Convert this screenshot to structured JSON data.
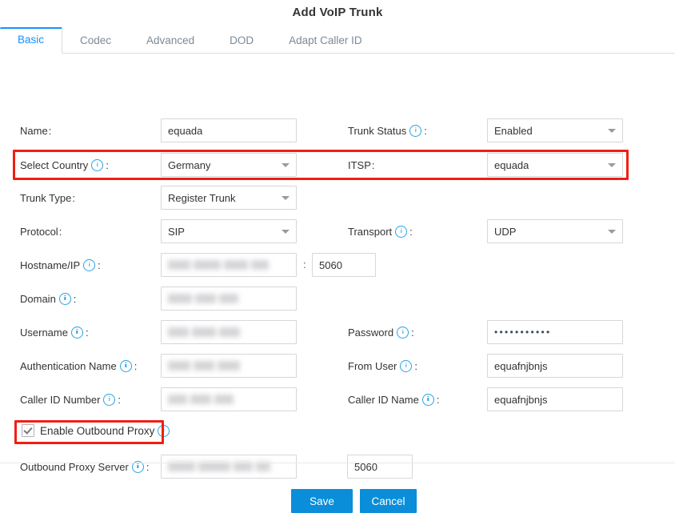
{
  "dialog": {
    "title": "Add VoIP Trunk"
  },
  "tabs": [
    {
      "label": "Basic",
      "active": true
    },
    {
      "label": "Codec",
      "active": false
    },
    {
      "label": "Advanced",
      "active": false
    },
    {
      "label": "DOD",
      "active": false
    },
    {
      "label": "Adapt Caller ID",
      "active": false
    }
  ],
  "fields": {
    "name": {
      "label": "Name",
      "value": "equada",
      "type": "text"
    },
    "trunk_status": {
      "label": "Trunk Status",
      "value": "Enabled",
      "type": "select",
      "info": true
    },
    "select_country": {
      "label": "Select Country",
      "value": "Germany",
      "type": "select",
      "info": true
    },
    "itsp": {
      "label": "ITSP",
      "value": "equada",
      "type": "select"
    },
    "trunk_type": {
      "label": "Trunk Type",
      "value": "Register Trunk",
      "type": "select"
    },
    "protocol": {
      "label": "Protocol",
      "value": "SIP",
      "type": "select"
    },
    "transport": {
      "label": "Transport",
      "value": "UDP",
      "type": "select",
      "info": true
    },
    "hostname_ip": {
      "label": "Hostname/IP",
      "value": "",
      "type": "text",
      "info": true,
      "redacted": true
    },
    "hostname_port": {
      "value": "5060",
      "type": "text"
    },
    "port_separator": ":",
    "domain": {
      "label": "Domain",
      "value": "",
      "type": "text",
      "info": true,
      "redacted": true
    },
    "username": {
      "label": "Username",
      "value": "",
      "type": "text",
      "info": true,
      "redacted": true
    },
    "password": {
      "label": "Password",
      "value": "•••••••••••",
      "type": "password",
      "info": true
    },
    "authentication_name": {
      "label": "Authentication Name",
      "value": "",
      "type": "text",
      "info": true,
      "redacted": true
    },
    "from_user": {
      "label": "From User",
      "value": "equafnjbnjs",
      "type": "text",
      "info": true
    },
    "caller_id_number": {
      "label": "Caller ID Number",
      "value": "",
      "type": "text",
      "info": true,
      "redacted": true
    },
    "caller_id_name": {
      "label": "Caller ID Name",
      "value": "equafnjbnjs",
      "type": "text",
      "info": true
    },
    "enable_outbound_proxy": {
      "label": "Enable Outbound Proxy",
      "checked": true,
      "info": true
    },
    "outbound_proxy_server": {
      "label": "Outbound Proxy Server",
      "value": "",
      "type": "text",
      "info": true,
      "redacted": true
    },
    "outbound_proxy_port": {
      "value": "5060",
      "type": "text"
    }
  },
  "buttons": {
    "save": "Save",
    "cancel": "Cancel"
  },
  "colors": {
    "accent": "#1890ff",
    "button": "#0a8ed9",
    "highlight": "#f01f12",
    "info_icon": "#29a3e0"
  },
  "highlights": [
    {
      "name": "select-country-itsp-row"
    },
    {
      "name": "enable-outbound-proxy"
    }
  ]
}
